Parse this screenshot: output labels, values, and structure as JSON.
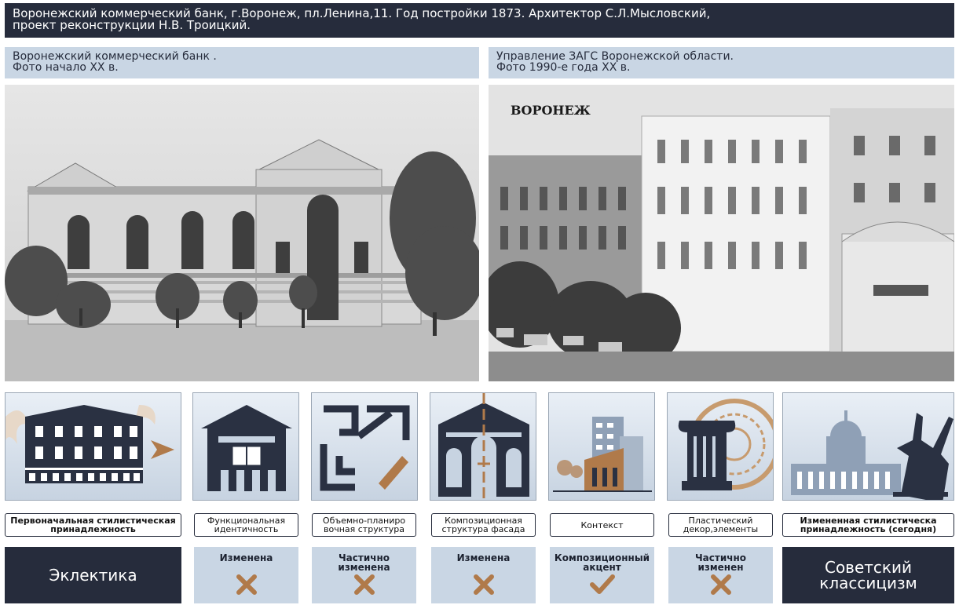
{
  "header": {
    "title_line1": "Воронежский коммерческий банк,  г.Воронеж, пл.Ленина,11. Год постройки 1873. Архитектор С.Л.Мысловский,",
    "title_line2": "проект реконструкции Н.В. Троицкий."
  },
  "left_photo": {
    "caption_line1": "Воронежский коммерческий банк .",
    "caption_line2": "Фото начало XX в."
  },
  "right_photo": {
    "caption_line1": "Управление ЗАГС Воронежской области.",
    "caption_line2": "Фото 1990-е года XX в.",
    "overlay_text": "ВОРОНЕЖ"
  },
  "criteria": [
    {
      "label": "Первоначальная стилистическая принадлежность",
      "icon": "classical-building-icon"
    },
    {
      "label": "Функциональная идентичность",
      "icon": "library-book-icon"
    },
    {
      "label": "Объемно-планиро вочная структура",
      "icon": "floor-plan-icon"
    },
    {
      "label": "Композиционная структура фасада",
      "icon": "facade-icon"
    },
    {
      "label": "Контекст",
      "icon": "city-context-icon"
    },
    {
      "label": "Пластический декор,элементы",
      "icon": "column-ornament-icon"
    },
    {
      "label": "Измененная стилистическа принадлежность (сегодня)",
      "icon": "soviet-monument-icon"
    }
  ],
  "results": {
    "original_style": "Эклектика",
    "current_style_line1": "Советский",
    "current_style_line2": "классицизм",
    "statuses": [
      {
        "text": "Изменена",
        "mark": "cross-icon"
      },
      {
        "text": "Частично изменена",
        "mark": "cross-icon"
      },
      {
        "text": "Изменена",
        "mark": "cross-icon"
      },
      {
        "text": "Композиционный акцент",
        "mark": "check-icon"
      },
      {
        "text": "Частично изменен",
        "mark": "cross-icon"
      }
    ]
  },
  "colors": {
    "dark": "#262c3c",
    "light_blue": "#c9d6e4",
    "accent_brown": "#b07a4a"
  }
}
